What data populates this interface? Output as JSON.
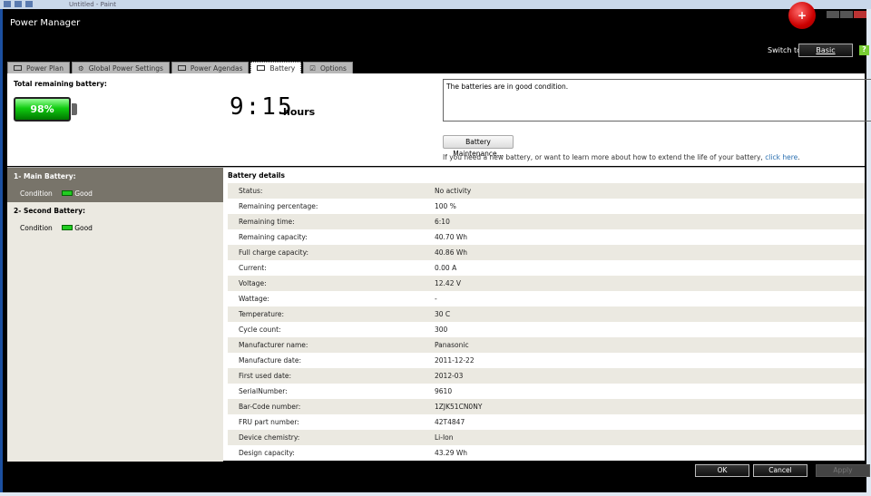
{
  "paint_title": "Untitled - Paint",
  "app_title": "Power Manager",
  "switch_label": "Switch to:",
  "switch_button": "Basic",
  "help": "?",
  "tabs": [
    {
      "label": "Power Plan"
    },
    {
      "label": "Global Power Settings"
    },
    {
      "label": "Power Agendas"
    },
    {
      "label": "Battery",
      "active": true
    },
    {
      "label": "Options"
    }
  ],
  "summary": {
    "label": "Total remaining battery:",
    "percent": "98%",
    "percent_value": 98,
    "time": "9:15",
    "time_unit": "hours",
    "message": "The batteries are in good condition.",
    "maintenance_button": "Battery Maintenance...",
    "hint": "If you need a new battery, or want to learn more about how to extend the life of your battery, ",
    "hint_link": "click here",
    "hint_end": "."
  },
  "batteries": [
    {
      "name": "1- Main Battery:",
      "condition_label": "Condition",
      "condition": "Good"
    },
    {
      "name": "2- Second Battery:",
      "condition_label": "Condition",
      "condition": "Good"
    }
  ],
  "details": {
    "title": "Battery details",
    "rows": [
      [
        "Status:",
        "No activity"
      ],
      [
        "Remaining percentage:",
        "100 %"
      ],
      [
        "Remaining time:",
        "6:10"
      ],
      [
        "Remaining capacity:",
        "40.70 Wh"
      ],
      [
        "Full charge capacity:",
        "40.86 Wh"
      ],
      [
        "Current:",
        "0.00 A"
      ],
      [
        "Voltage:",
        "12.42 V"
      ],
      [
        "Wattage:",
        "-"
      ],
      [
        "Temperature:",
        "30 C"
      ],
      [
        "Cycle count:",
        "300"
      ],
      [
        "Manufacturer name:",
        "Panasonic"
      ],
      [
        "Manufacture date:",
        "2011-12-22"
      ],
      [
        "First used date:",
        "2012-03"
      ],
      [
        "SerialNumber:",
        "9610"
      ],
      [
        "Bar-Code number:",
        "1ZJK51CN0NY"
      ],
      [
        "FRU part number:",
        "42T4847"
      ],
      [
        "Device chemistry:",
        "Li-Ion"
      ],
      [
        "Design capacity:",
        "43.29 Wh"
      ]
    ]
  },
  "buttons": {
    "ok": "OK",
    "cancel": "Cancel",
    "apply": "Apply"
  }
}
